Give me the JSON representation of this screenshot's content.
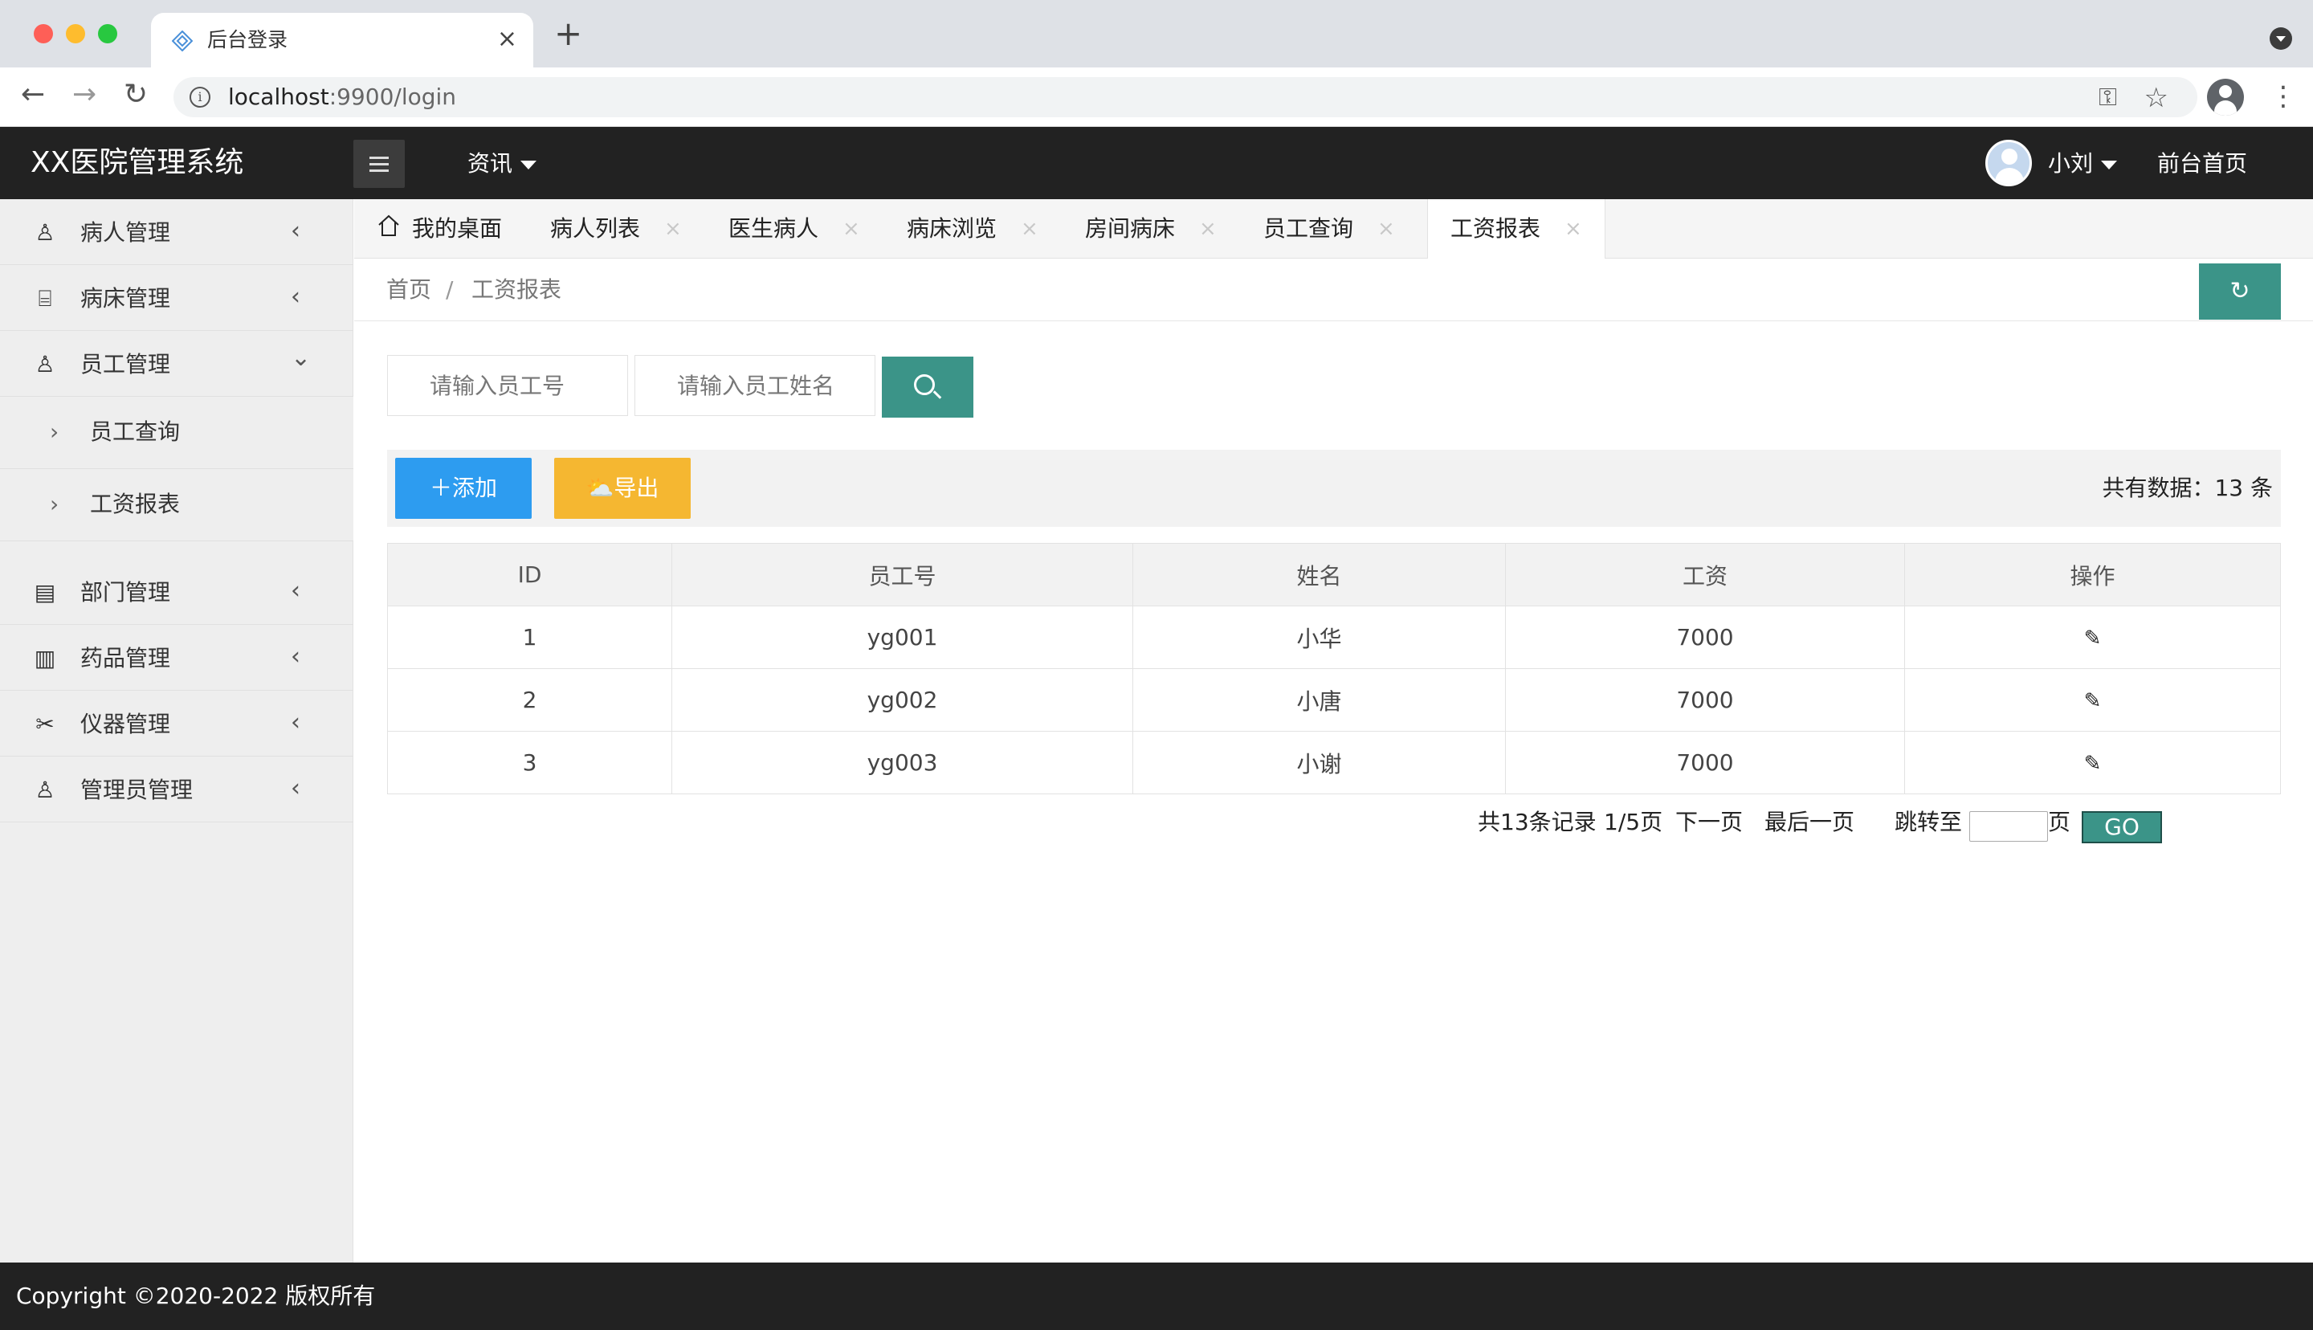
{
  "browser": {
    "tab_title": "后台登录",
    "tab_close": "×",
    "new_tab": "+",
    "url_host": "localhost",
    "url_rest": ":9900/login",
    "back": "←",
    "forward": "→",
    "reload": "↻",
    "key_icon": "⚿",
    "star_icon": "☆",
    "kebab": "⋮"
  },
  "header": {
    "logo": "XX医院管理系统",
    "news_menu": "资讯",
    "user_name": "小刘",
    "front_link": "前台首页"
  },
  "sidebar": {
    "items": [
      {
        "label": "病人管理",
        "icon": "user-icon",
        "glyph": "♙",
        "chevron": "‹"
      },
      {
        "label": "病床管理",
        "icon": "sofa-icon",
        "glyph": "⌸",
        "chevron": "‹"
      },
      {
        "label": "员工管理",
        "icon": "users-icon",
        "glyph": "♙",
        "chevron": "⌄"
      },
      {
        "label": "员工查询",
        "arrow": "›"
      },
      {
        "label": "工资报表",
        "arrow": "›"
      },
      {
        "label": "部门管理",
        "icon": "calendar-icon",
        "glyph": "▤",
        "chevron": "‹"
      },
      {
        "label": "药品管理",
        "icon": "clipboard-icon",
        "glyph": "▥",
        "chevron": "‹"
      },
      {
        "label": "仪器管理",
        "icon": "tools-icon",
        "glyph": "✂",
        "chevron": "‹"
      },
      {
        "label": "管理员管理",
        "icon": "admin-icon",
        "glyph": "♙",
        "chevron": "‹"
      }
    ]
  },
  "page_tabs": [
    {
      "label": "我的桌面"
    },
    {
      "label": "病人列表",
      "close": "×"
    },
    {
      "label": "医生病人",
      "close": "×"
    },
    {
      "label": "病床浏览",
      "close": "×"
    },
    {
      "label": "房间病床",
      "close": "×"
    },
    {
      "label": "员工查询",
      "close": "×"
    },
    {
      "label": "工资报表",
      "close": "×"
    }
  ],
  "breadcrumb": {
    "home": "首页",
    "separator": "/",
    "current": "工资报表",
    "refresh": "↻"
  },
  "search": {
    "id_placeholder": "请输入员工号",
    "name_placeholder": "请输入员工姓名"
  },
  "actions": {
    "add": "＋添加",
    "export": "⛅导出",
    "total": "共有数据：13 条"
  },
  "table": {
    "headers": [
      "ID",
      "员工号",
      "姓名",
      "工资",
      "操作"
    ],
    "rows": [
      {
        "id": "1",
        "no": "yg001",
        "name": "小华",
        "salary": "7000"
      },
      {
        "id": "2",
        "no": "yg002",
        "name": "小唐",
        "salary": "7000"
      },
      {
        "id": "3",
        "no": "yg003",
        "name": "小谢",
        "salary": "7000"
      }
    ],
    "edit_glyph": "✎"
  },
  "pager": {
    "records": "共13条记录",
    "page": "1/5页",
    "next": "下一页",
    "last": "最后一页",
    "jump": "跳转至",
    "page_unit": "页",
    "go": "GO"
  },
  "footer": {
    "copyright": "Copyright ©2020-2022 版权所有"
  },
  "colors": {
    "teal": "#3b9488",
    "blue": "#2d9cf0",
    "orange": "#f5b731",
    "header_bg": "#222222"
  }
}
